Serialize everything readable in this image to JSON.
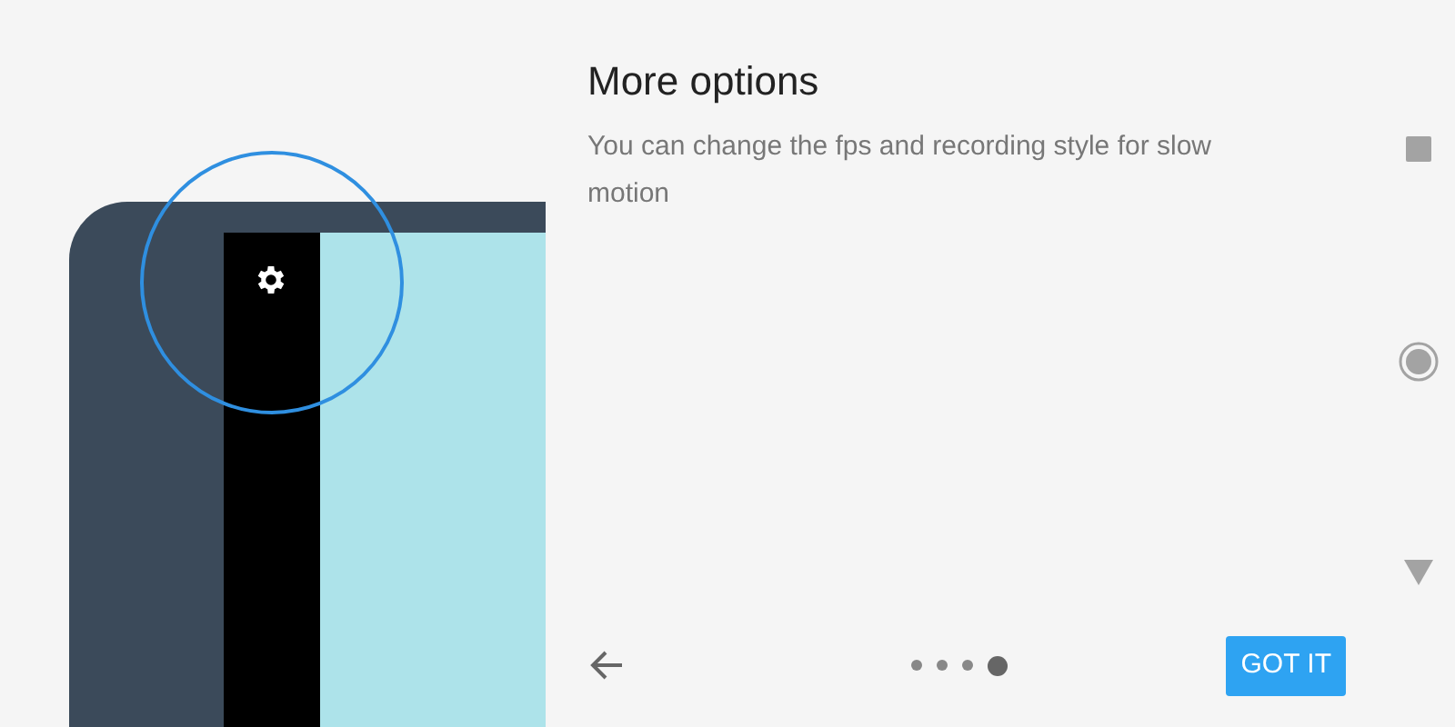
{
  "title": "More options",
  "description": "You can change the fps and recording style for slow motion",
  "pager": [
    {
      "selected": false
    },
    {
      "selected": false
    },
    {
      "selected": false
    },
    {
      "selected": true
    }
  ],
  "button": "GOT IT"
}
